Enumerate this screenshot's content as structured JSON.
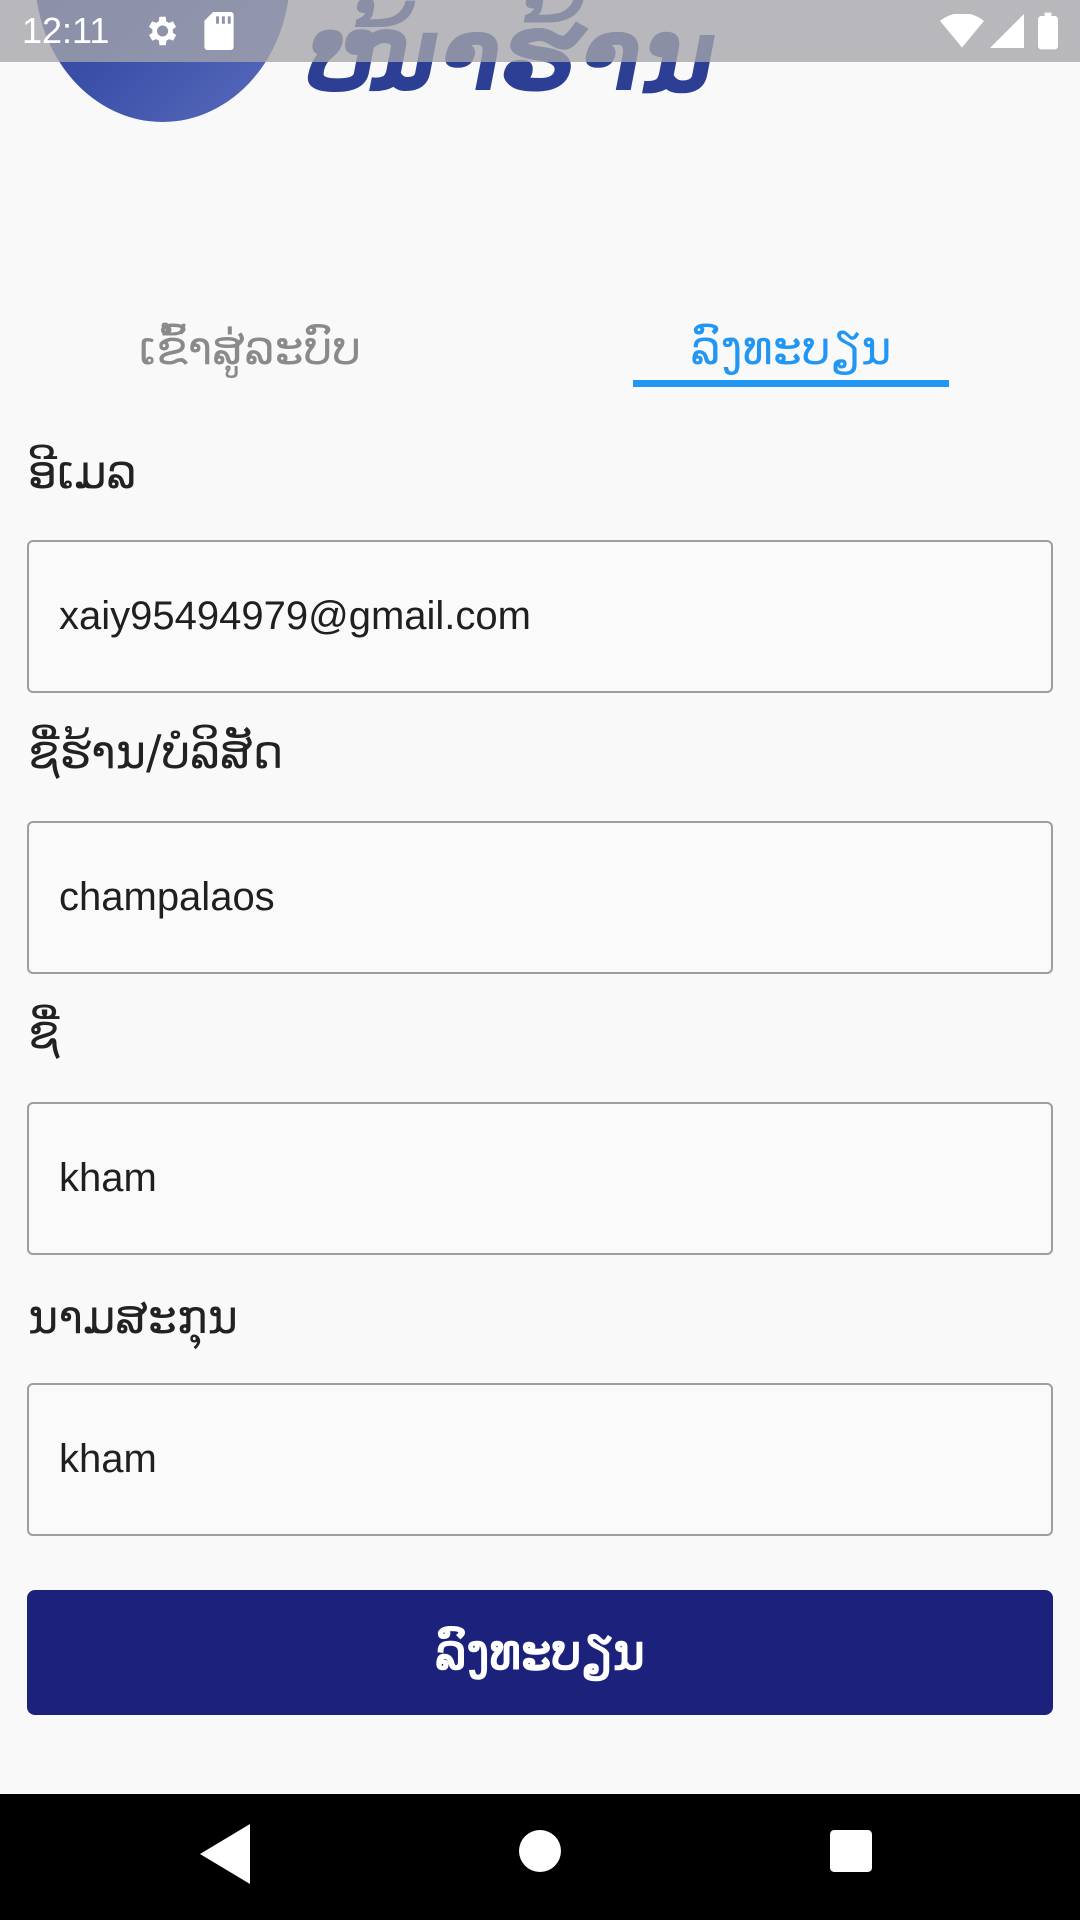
{
  "status_bar": {
    "time": "12:11",
    "icons": [
      "gear-icon",
      "sd-card-icon",
      "wifi-icon",
      "signal-icon",
      "battery-icon"
    ]
  },
  "brand": {
    "title": "ໜ້າຮ້ານ",
    "color": "#2c3f95"
  },
  "tabs": [
    {
      "label": "ເຂົ້າສູ່ລະບົບ",
      "active": false
    },
    {
      "label": "ລົງທະບຽນ",
      "active": true
    }
  ],
  "form": {
    "email": {
      "label": "ອີເມລ",
      "value": "xaiy95494979@gmail.com"
    },
    "store": {
      "label": "ຊື່ຮ້ານ/ບໍລິສັດ",
      "value": "champalaos"
    },
    "first_name": {
      "label": "ຊື່",
      "value": "kham"
    },
    "last_name": {
      "label": "ນາມສະກຸນ",
      "value": "kham"
    }
  },
  "submit": {
    "label": "ລົງທະບຽນ"
  },
  "colors": {
    "accent": "#2196f3",
    "button": "#1c227b",
    "background": "#f9f9fa"
  },
  "nav_bar": {
    "icons": [
      "back-icon",
      "home-icon",
      "recents-icon"
    ]
  }
}
